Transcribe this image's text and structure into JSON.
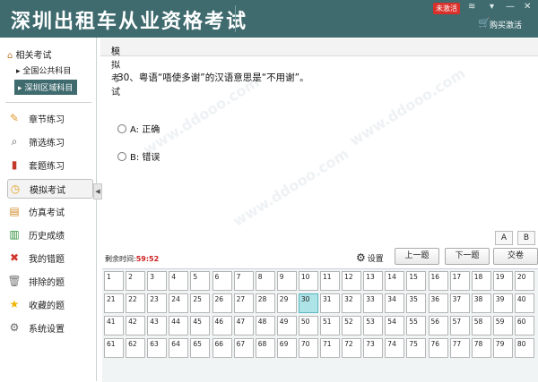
{
  "window": {
    "title": "深圳出租车从业资格考试",
    "unregistered_badge": "未激活",
    "buy_label": "购买激活"
  },
  "sidebar": {
    "section_label": "相关考试",
    "sub_items": [
      {
        "label": "全国公共科目",
        "active": false
      },
      {
        "label": "深圳区域科目",
        "active": true
      }
    ],
    "nav_items": [
      {
        "label": "章节练习",
        "icon": "pencil-icon",
        "active": false
      },
      {
        "label": "筛选练习",
        "icon": "magnifier-icon",
        "active": false
      },
      {
        "label": "套题练习",
        "icon": "books-icon",
        "active": false
      },
      {
        "label": "模拟考试",
        "icon": "clock-icon",
        "active": true
      },
      {
        "label": "仿真考试",
        "icon": "notebook-icon",
        "active": false
      },
      {
        "label": "历史成绩",
        "icon": "bar-chart-icon",
        "active": false
      },
      {
        "label": "我的错题",
        "icon": "cross-icon",
        "active": false
      },
      {
        "label": "排除的题",
        "icon": "trash-icon",
        "active": false
      },
      {
        "label": "收藏的题",
        "icon": "star-icon",
        "active": false
      },
      {
        "label": "系统设置",
        "icon": "gear-icon",
        "active": false
      }
    ]
  },
  "breadcrumb": "模拟考试",
  "question": {
    "text": "30、粤语“唔使多谢”的汉语意思是“不用谢”。",
    "options": [
      "A: 正确",
      "B: 错误"
    ]
  },
  "font_size_buttons": [
    "A",
    "B"
  ],
  "timer": {
    "label": "剩余时间:",
    "value": "59:52"
  },
  "controls": {
    "settings_label": "设置",
    "prev_label": "上一题",
    "next_label": "下一题",
    "submit_label": "交卷"
  },
  "answer_sheet": {
    "numbers": [
      1,
      2,
      3,
      4,
      5,
      6,
      7,
      8,
      9,
      10,
      11,
      12,
      13,
      14,
      15,
      16,
      17,
      18,
      19,
      20,
      21,
      22,
      23,
      24,
      25,
      26,
      27,
      28,
      29,
      30,
      31,
      32,
      33,
      34,
      35,
      36,
      37,
      38,
      39,
      40,
      41,
      42,
      43,
      44,
      45,
      46,
      47,
      48,
      49,
      50,
      51,
      52,
      53,
      54,
      55,
      56,
      57,
      58,
      59,
      60,
      61,
      62,
      63,
      64,
      65,
      66,
      67,
      68,
      69,
      70,
      71,
      72,
      73,
      74,
      75,
      76,
      77,
      78,
      79,
      80
    ],
    "current": 30
  }
}
